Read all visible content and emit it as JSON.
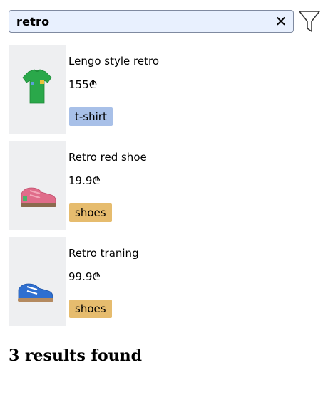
{
  "search": {
    "value": "retro",
    "clear_icon": "close-icon",
    "filter_icon": "filter-icon"
  },
  "products": [
    {
      "name": "Lengo style retro",
      "price": "155₾",
      "tag": "t-shirt",
      "tag_color": "#a8c0e8",
      "image": "green-t-shirt"
    },
    {
      "name": "Retro red shoe",
      "price": "19.9₾",
      "tag": "shoes",
      "tag_color": "#e6bc6e",
      "image": "pink-sneaker"
    },
    {
      "name": "Retro traning",
      "price": "99.9₾",
      "tag": "shoes",
      "tag_color": "#e6bc6e",
      "image": "blue-sneaker"
    }
  ],
  "results_text": "3 results found"
}
